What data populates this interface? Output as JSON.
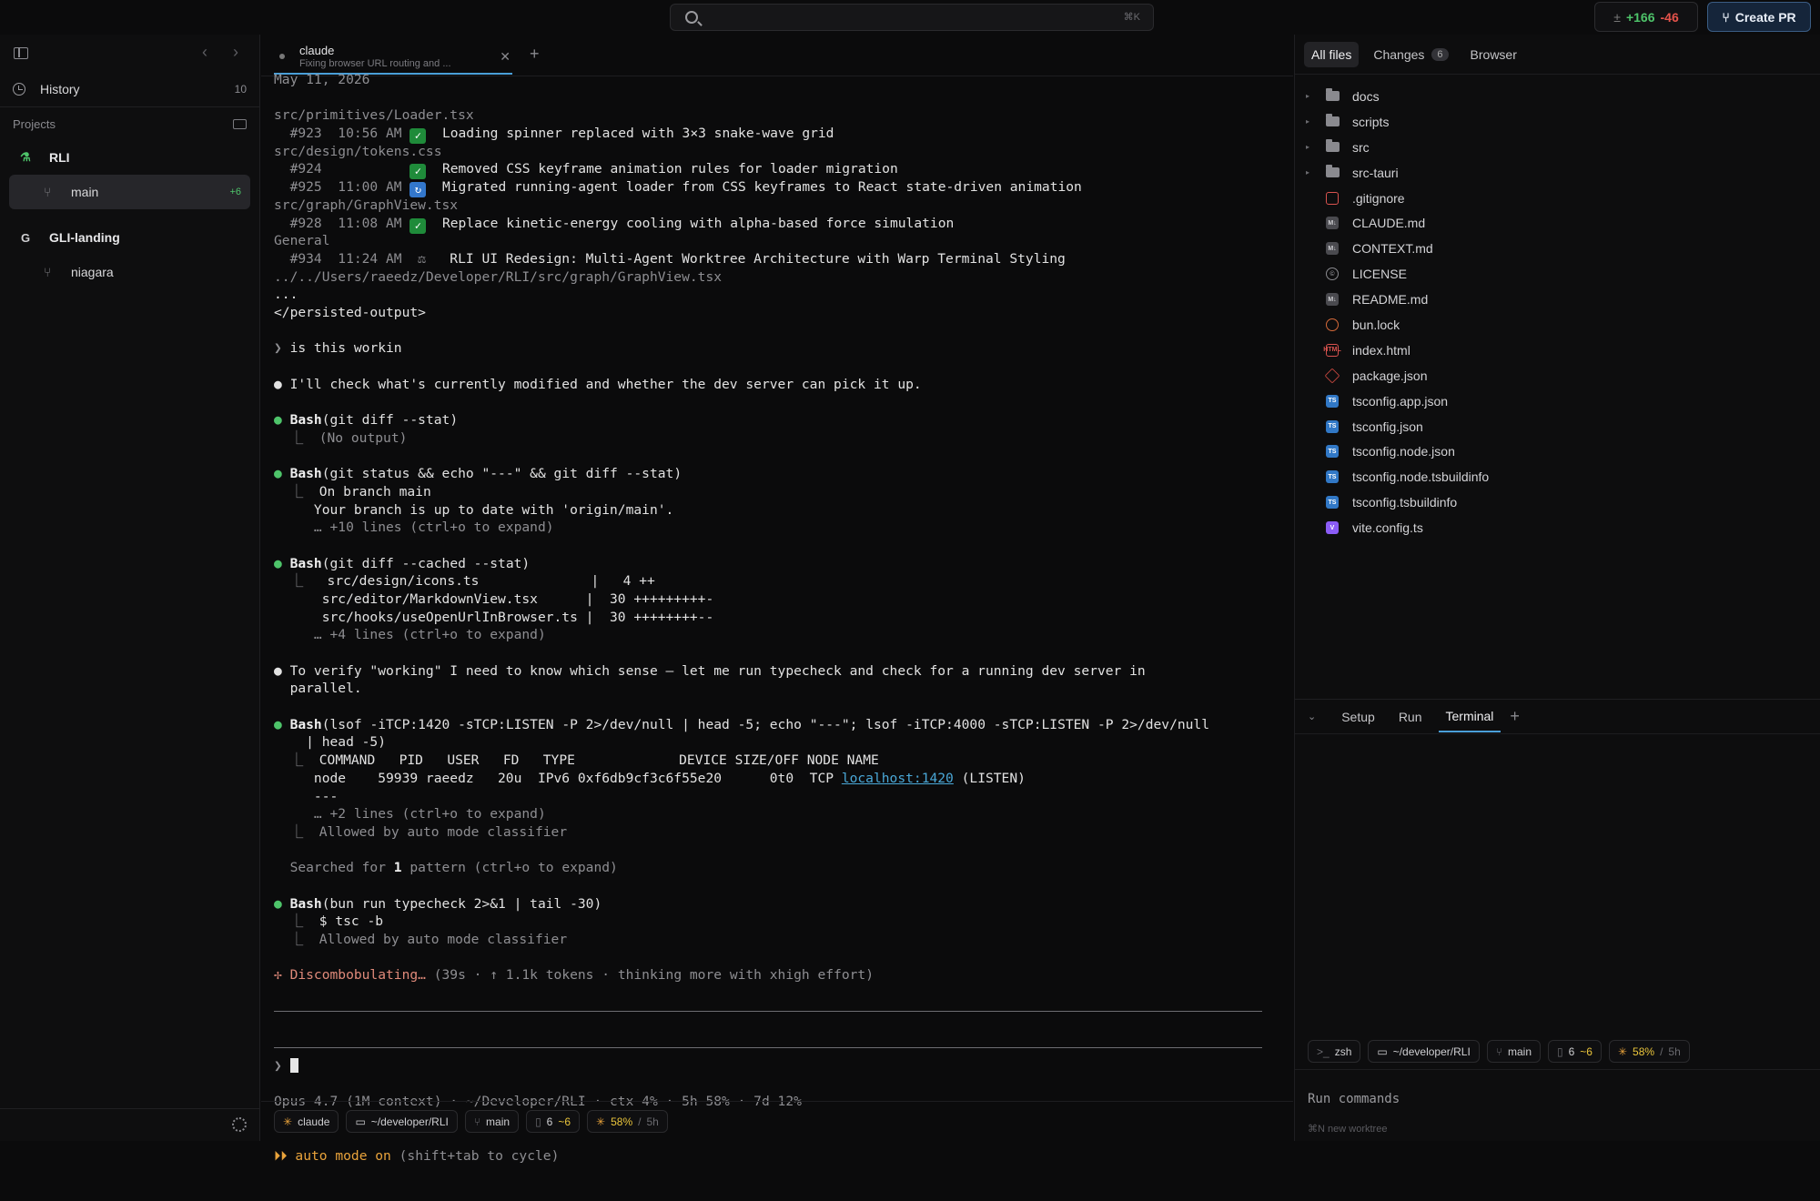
{
  "topbar": {
    "search_shortcut": "⌘K",
    "diff_added": "+166",
    "diff_removed": "-46",
    "create_pr_label": "Create PR"
  },
  "sidebar": {
    "history_label": "History",
    "history_count": "10",
    "projects_label": "Projects",
    "projects": [
      {
        "name": "RLI",
        "icon": "flask-icon",
        "worktrees": [
          {
            "name": "main",
            "badge": "+6",
            "active": true
          }
        ]
      },
      {
        "name": "GLI-landing",
        "icon_letter": "G",
        "worktrees": [
          {
            "name": "niagara",
            "badge": "",
            "active": false
          }
        ]
      }
    ]
  },
  "tab": {
    "title": "claude",
    "subtitle": "Fixing browser URL routing and ..."
  },
  "terminal": {
    "lines": [
      {
        "segs": [
          [
            "dim",
            "May 11, 2026"
          ]
        ]
      },
      {
        "segs": [
          [
            "",
            ""
          ]
        ]
      },
      {
        "segs": [
          [
            "dim",
            "src/primitives/Loader.tsx"
          ]
        ]
      },
      {
        "segs": [
          [
            "dim",
            "  #923  10:56 AM "
          ],
          [
            "emoji-green",
            "✓"
          ],
          [
            "",
            "  Loading spinner replaced with 3×3 snake-wave grid"
          ]
        ]
      },
      {
        "segs": [
          [
            "dim",
            "src/design/tokens.css"
          ]
        ]
      },
      {
        "segs": [
          [
            "dim",
            "  #924           "
          ],
          [
            "emoji-green",
            "✓"
          ],
          [
            "",
            "  Removed CSS keyframe animation rules for loader migration"
          ]
        ]
      },
      {
        "segs": [
          [
            "dim",
            "  #925  11:00 AM "
          ],
          [
            "emoji-blue",
            "↻"
          ],
          [
            "",
            "  Migrated running-agent loader from CSS keyframes to React state-driven animation"
          ]
        ]
      },
      {
        "segs": [
          [
            "dim",
            "src/graph/GraphView.tsx"
          ]
        ]
      },
      {
        "segs": [
          [
            "dim",
            "  #928  11:08 AM "
          ],
          [
            "emoji-green",
            "✓"
          ],
          [
            "",
            "  Replace kinetic-energy cooling with alpha-based force simulation"
          ]
        ]
      },
      {
        "segs": [
          [
            "dim",
            "General"
          ]
        ]
      },
      {
        "segs": [
          [
            "dim",
            "  #934  11:24 AM  ⚖  "
          ],
          [
            "",
            " RLI UI Redesign: Multi-Agent Worktree Architecture with Warp Terminal Styling"
          ]
        ]
      },
      {
        "segs": [
          [
            "dim",
            "../../Users/raeedz/Developer/RLI/src/graph/GraphView.tsx"
          ]
        ]
      },
      {
        "segs": [
          [
            "",
            "..."
          ]
        ]
      },
      {
        "segs": [
          [
            "",
            "</persisted-output>"
          ]
        ]
      },
      {
        "segs": [
          [
            "",
            ""
          ]
        ]
      },
      {
        "segs": [
          [
            "dim",
            "❯ "
          ],
          [
            "",
            "is this workin"
          ]
        ]
      },
      {
        "segs": [
          [
            "",
            ""
          ]
        ]
      },
      {
        "segs": [
          [
            "",
            "● I'll check what's currently modified and whether the dev server can pick it up."
          ]
        ]
      },
      {
        "segs": [
          [
            "",
            ""
          ]
        ]
      },
      {
        "segs": [
          [
            "gd",
            "● "
          ],
          [
            "b",
            "Bash"
          ],
          [
            "",
            "(git diff --stat)"
          ]
        ]
      },
      {
        "segs": [
          [
            "dim",
            "  ⎿  (No output)"
          ]
        ]
      },
      {
        "segs": [
          [
            "",
            ""
          ]
        ]
      },
      {
        "segs": [
          [
            "gd",
            "● "
          ],
          [
            "b",
            "Bash"
          ],
          [
            "",
            "(git status && echo \"---\" && git diff --stat)"
          ]
        ]
      },
      {
        "segs": [
          [
            "dim",
            "  ⎿  "
          ],
          [
            "",
            "On branch main"
          ]
        ]
      },
      {
        "segs": [
          [
            "",
            "     Your branch is up to date with 'origin/main'."
          ]
        ]
      },
      {
        "segs": [
          [
            "dim",
            "     … +10 lines (ctrl+o to expand)"
          ]
        ]
      },
      {
        "segs": [
          [
            "",
            ""
          ]
        ]
      },
      {
        "segs": [
          [
            "gd",
            "● "
          ],
          [
            "b",
            "Bash"
          ],
          [
            "",
            "(git diff --cached --stat)"
          ]
        ]
      },
      {
        "segs": [
          [
            "dim",
            "  ⎿  "
          ],
          [
            "",
            " src/design/icons.ts              |   4 ++"
          ]
        ]
      },
      {
        "segs": [
          [
            "",
            "      src/editor/MarkdownView.tsx      |  30 +++++++++-"
          ]
        ]
      },
      {
        "segs": [
          [
            "",
            "      src/hooks/useOpenUrlInBrowser.ts |  30 ++++++++--"
          ]
        ]
      },
      {
        "segs": [
          [
            "dim",
            "     … +4 lines (ctrl+o to expand)"
          ]
        ]
      },
      {
        "segs": [
          [
            "",
            ""
          ]
        ]
      },
      {
        "segs": [
          [
            "",
            "● To verify \"working\" I need to know which sense — let me run typecheck and check for a running dev server in"
          ]
        ]
      },
      {
        "segs": [
          [
            "",
            "  parallel."
          ]
        ]
      },
      {
        "segs": [
          [
            "",
            ""
          ]
        ]
      },
      {
        "segs": [
          [
            "gd",
            "● "
          ],
          [
            "b",
            "Bash"
          ],
          [
            "",
            "(lsof -iTCP:1420 -sTCP:LISTEN -P 2>/dev/null | head -5; echo \"---\"; lsof -iTCP:4000 -sTCP:LISTEN -P 2>/dev/null"
          ]
        ]
      },
      {
        "segs": [
          [
            "",
            "    | head -5)"
          ]
        ]
      },
      {
        "segs": [
          [
            "dim",
            "  ⎿  "
          ],
          [
            "",
            "COMMAND   PID   USER   FD   TYPE             DEVICE SIZE/OFF NODE NAME"
          ]
        ]
      },
      {
        "segs": [
          [
            "",
            "     node    59939 raeedz   20u  IPv6 0xf6db9cf3c6f55e20      0t0  TCP "
          ],
          [
            "link",
            "localhost:1420"
          ],
          [
            "",
            " (LISTEN)"
          ]
        ]
      },
      {
        "segs": [
          [
            "",
            "     ---"
          ]
        ]
      },
      {
        "segs": [
          [
            "dim",
            "     … +2 lines (ctrl+o to expand)"
          ]
        ]
      },
      {
        "segs": [
          [
            "dim",
            "  ⎿  Allowed by auto mode classifier"
          ]
        ]
      },
      {
        "segs": [
          [
            "",
            ""
          ]
        ]
      },
      {
        "segs": [
          [
            "dim",
            "  Searched for "
          ],
          [
            "b",
            "1"
          ],
          [
            "dim",
            " pattern (ctrl+o to expand)"
          ]
        ]
      },
      {
        "segs": [
          [
            "",
            ""
          ]
        ]
      },
      {
        "segs": [
          [
            "gd",
            "● "
          ],
          [
            "b",
            "Bash"
          ],
          [
            "",
            "(bun run typecheck 2>&1 | tail -30)"
          ]
        ]
      },
      {
        "segs": [
          [
            "dim",
            "  ⎿  "
          ],
          [
            "",
            "$ tsc -b"
          ]
        ]
      },
      {
        "segs": [
          [
            "dim",
            "  ⎿  Allowed by auto mode classifier"
          ]
        ]
      },
      {
        "segs": [
          [
            "",
            ""
          ]
        ]
      },
      {
        "segs": [
          [
            "salmon",
            "✢ Discombobulating… "
          ],
          [
            "dim",
            "(39s · ↑ 1.1k tokens · thinking more with xhigh effort)"
          ]
        ]
      }
    ],
    "prompt_char": "❯",
    "status_line": "Opus 4.7 (1M context) · ~/Developer/RLI · ctx 4% · 5h 58% · 7d 12%",
    "mode_arrows": "⏵⏵",
    "mode_label": "auto mode on",
    "mode_hint": "(shift+tab to cycle)"
  },
  "bottombar": {
    "agent": "claude",
    "path": "~/developer/RLI",
    "branch": "main",
    "files": "6",
    "files_mod": "~6",
    "usage": "58%",
    "usage_window": "5h"
  },
  "right_panel": {
    "tabs": [
      {
        "label": "All files",
        "active": true
      },
      {
        "label": "Changes",
        "count": "6",
        "active": false
      },
      {
        "label": "Browser",
        "active": false
      }
    ],
    "tree": [
      {
        "name": "docs",
        "type": "folder"
      },
      {
        "name": "scripts",
        "type": "folder"
      },
      {
        "name": "src",
        "type": "folder"
      },
      {
        "name": "src-tauri",
        "type": "folder"
      },
      {
        "name": ".gitignore",
        "type": "git"
      },
      {
        "name": "CLAUDE.md",
        "type": "md"
      },
      {
        "name": "CONTEXT.md",
        "type": "md"
      },
      {
        "name": "LICENSE",
        "type": "lic"
      },
      {
        "name": "README.md",
        "type": "md"
      },
      {
        "name": "bun.lock",
        "type": "lock"
      },
      {
        "name": "index.html",
        "type": "html"
      },
      {
        "name": "package.json",
        "type": "pkg"
      },
      {
        "name": "tsconfig.app.json",
        "type": "ts"
      },
      {
        "name": "tsconfig.json",
        "type": "ts"
      },
      {
        "name": "tsconfig.node.json",
        "type": "ts"
      },
      {
        "name": "tsconfig.node.tsbuildinfo",
        "type": "ts"
      },
      {
        "name": "tsconfig.tsbuildinfo",
        "type": "ts"
      },
      {
        "name": "vite.config.ts",
        "type": "vite"
      }
    ],
    "term_tabs": [
      {
        "label": "Setup",
        "active": false
      },
      {
        "label": "Run",
        "active": false
      },
      {
        "label": "Terminal",
        "active": true
      }
    ],
    "term_pills": {
      "shell": "zsh",
      "shell_prefix": ">_",
      "path": "~/developer/RLI",
      "branch": "main",
      "files": "6",
      "files_mod": "~6",
      "usage": "58%",
      "usage_window": "5h"
    },
    "run_placeholder": "Run commands",
    "new_worktree_hint": "new worktree",
    "new_worktree_key": "⌘N"
  }
}
